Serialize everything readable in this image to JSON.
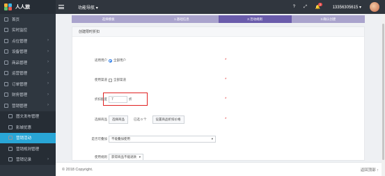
{
  "app": {
    "title": "人人旅"
  },
  "sidebar": {
    "items": [
      {
        "label": "首页",
        "has_arrow": false
      },
      {
        "label": "实时监控",
        "has_arrow": false
      },
      {
        "label": "点位管理",
        "has_arrow": true
      },
      {
        "label": "设备管理",
        "has_arrow": true
      },
      {
        "label": "商品管理",
        "has_arrow": true
      },
      {
        "label": "运营管理",
        "has_arrow": true
      },
      {
        "label": "订单管理",
        "has_arrow": true
      },
      {
        "label": "财务管理",
        "has_arrow": true
      },
      {
        "label": "营销管理",
        "has_arrow": true
      }
    ],
    "sub_items": [
      {
        "label": "图文发布管理",
        "active": false
      },
      {
        "label": "影城优惠",
        "active": false
      },
      {
        "label": "营销活动",
        "active": true
      },
      {
        "label": "营销规则管理",
        "active": false
      },
      {
        "label": "营销记录",
        "active": false
      }
    ]
  },
  "topbar": {
    "nav_label": "功能导航",
    "help_icon": "?",
    "expand_icon": "⤢",
    "notifications_count": "2",
    "phone": "13356305615"
  },
  "steps": [
    "选择模板",
    "1.基础信息",
    "2.活动规则",
    "3.确认创建"
  ],
  "form": {
    "section_title": "创建限时折扣",
    "fields": {
      "users_label": "适用用户",
      "users_option": "全部用户",
      "channel_label": "使用渠道",
      "channel_option": "全部渠道",
      "discount_label": "折扣额度",
      "discount_value": "7",
      "discount_unit": "折",
      "products_label": "选择商品",
      "products_btn": "选择商品",
      "products_selected": "已选 0 个",
      "products_set_btn": "设置商品折扣价格",
      "stack_label": "是否可叠加",
      "stack_value": "不能叠加使用",
      "rule_label": "使用规则",
      "rule_value": "获得商品不能退款"
    },
    "required_mark": "*"
  },
  "footer": {
    "copyright": "© 2018 Copyright.",
    "back_top": "返回顶部 ↑"
  }
}
